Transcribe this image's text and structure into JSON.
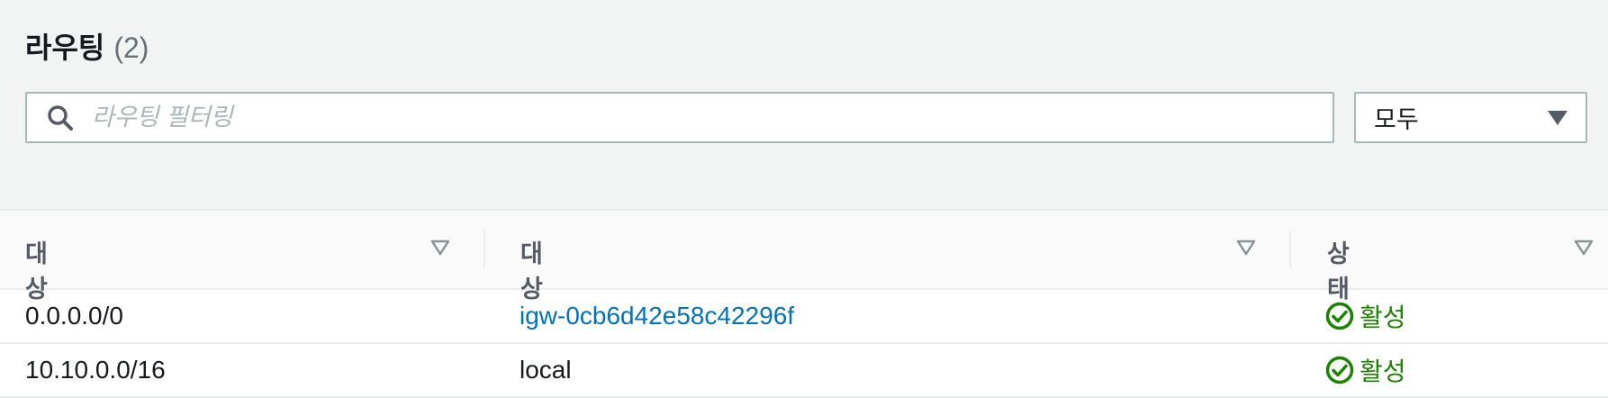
{
  "header": {
    "title": "라우팅",
    "count": "(2)"
  },
  "search": {
    "placeholder": "라우팅 필터링",
    "value": ""
  },
  "filter": {
    "selected": "모두"
  },
  "columns": [
    "대상",
    "대상",
    "상태"
  ],
  "rows": [
    {
      "destination": "0.0.0.0/0",
      "target": "igw-0cb6d42e58c42296f",
      "status": "활성"
    },
    {
      "destination": "10.10.0.0/16",
      "target": "local",
      "status": "활성"
    }
  ],
  "colors": {
    "link": "#0073bb",
    "status_ok": "#1d8102",
    "text": "#16191f",
    "muted": "#545b64"
  }
}
